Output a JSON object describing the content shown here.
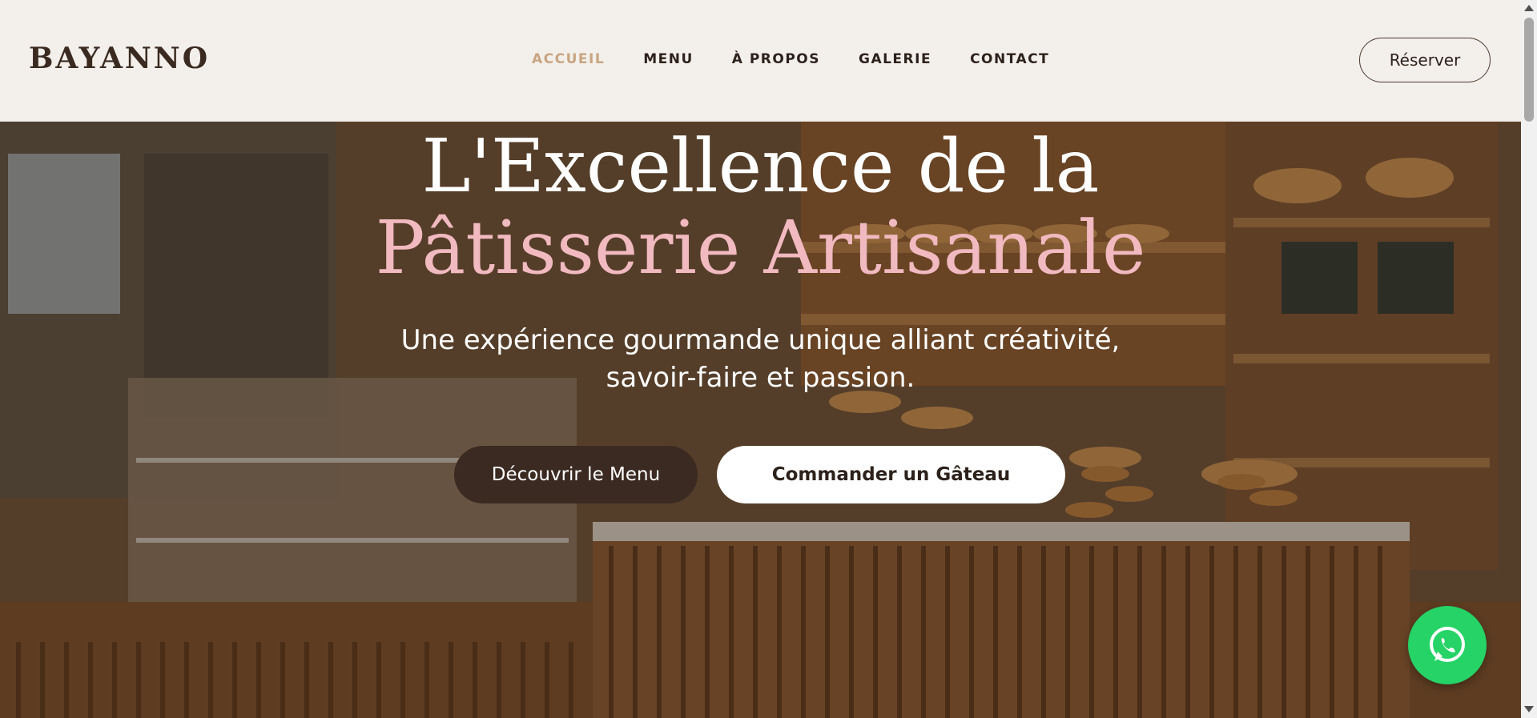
{
  "brand": {
    "logo": "BAYANNO"
  },
  "nav": {
    "items": [
      {
        "label": "ACCUEIL",
        "active": true
      },
      {
        "label": "MENU",
        "active": false
      },
      {
        "label": "À PROPOS",
        "active": false
      },
      {
        "label": "GALERIE",
        "active": false
      },
      {
        "label": "CONTACT",
        "active": false
      }
    ],
    "reserve_label": "Réserver"
  },
  "hero": {
    "title_line1": "L'Excellence de la",
    "title_line2": "Pâtisserie Artisanale",
    "subtitle_line1": "Une expérience gourmande unique alliant créativité,",
    "subtitle_line2": "savoir-faire et passion.",
    "primary_cta": "Découvrir le Menu",
    "secondary_cta": "Commander un Gâteau"
  },
  "colors": {
    "accent_active": "#c8a580",
    "title_pink": "#f1b9c0",
    "button_dark": "#3b2a21",
    "whatsapp": "#25d366"
  },
  "icons": {
    "whatsapp": "whatsapp-icon",
    "scroll_up": "scroll-up-arrow-icon",
    "scroll_down": "scroll-down-arrow-icon"
  }
}
